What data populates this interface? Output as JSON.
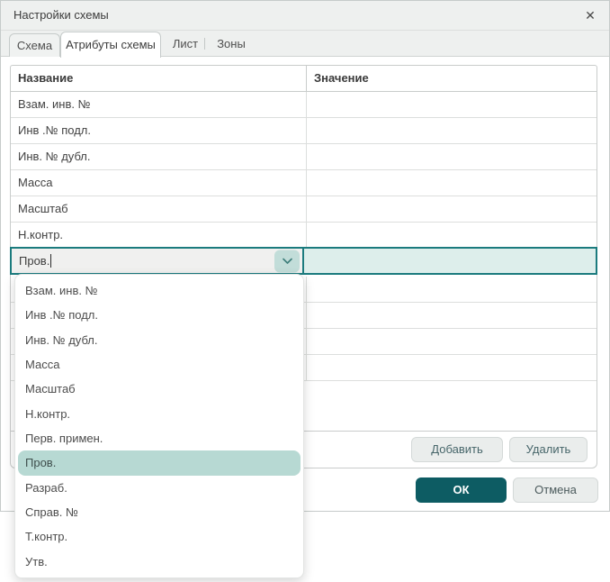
{
  "dialog": {
    "title": "Настройки схемы",
    "close_icon": "✕"
  },
  "tabs": {
    "items": [
      {
        "label": "Схема",
        "state": "inactive"
      },
      {
        "label": "Атрибуты схемы",
        "state": "active"
      },
      {
        "label": "Лист",
        "state": "flat"
      },
      {
        "label": "Зоны",
        "state": "flat"
      }
    ]
  },
  "table": {
    "columns": [
      "Название",
      "Значение"
    ],
    "rows": [
      "Взам. инв. №",
      "Инв .№ подл.",
      "Инв. № дубл.",
      "Масса",
      "Масштаб",
      "Н.контр."
    ],
    "empty_row_count": 4
  },
  "editor": {
    "value": "Пров."
  },
  "dropdown": {
    "items": [
      "Взам. инв. №",
      "Инв .№ подл.",
      "Инв. № дубл.",
      "Масса",
      "Масштаб",
      "Н.контр.",
      "Перв. примен.",
      "Пров.",
      "Разраб.",
      "Справ. №",
      "Т.контр.",
      "Утв."
    ],
    "selected": "Пров.",
    "selected_index": 7
  },
  "buttons": {
    "add": "Добавить",
    "delete": "Удалить",
    "ok": "ОК",
    "cancel": "Отмена"
  },
  "colors": {
    "accent_dark": "#0d5c63",
    "accent_border": "#1b7b7e",
    "value_cell_bg": "#ddeeeb",
    "chevron_bg": "#c2ddd9",
    "dropdown_highlight": "#b7d9d3",
    "header_bg": "#eef0ef"
  }
}
